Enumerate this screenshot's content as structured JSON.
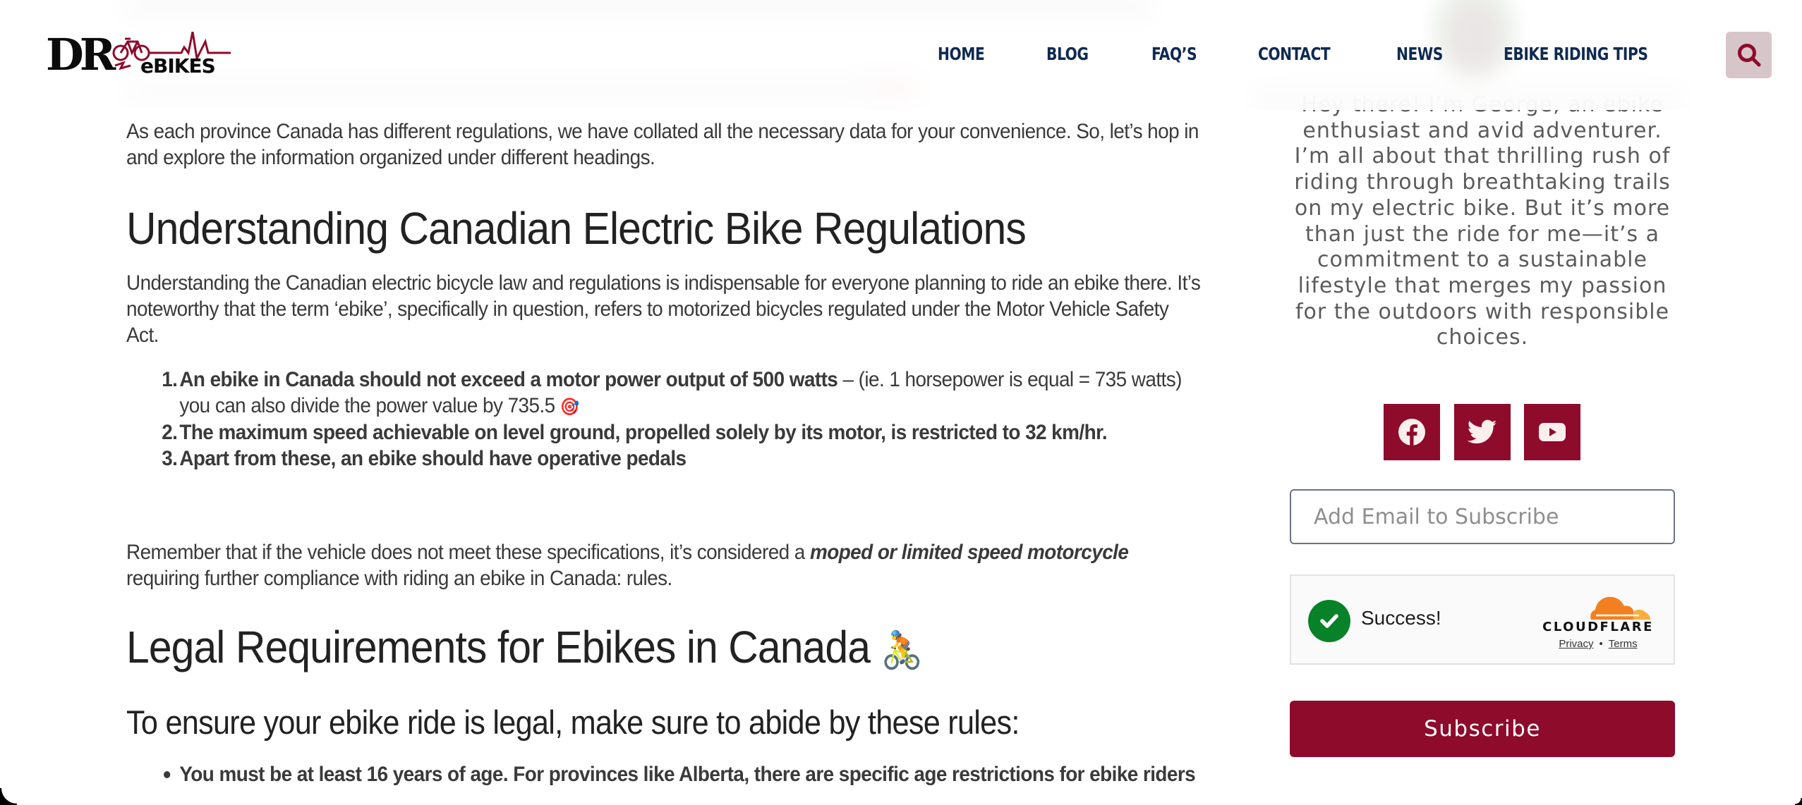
{
  "header": {
    "logo": {
      "primary": "DR",
      "secondary": "eBIKES",
      "alt": "DR eBIKES logo"
    },
    "nav": [
      {
        "label": "HOME"
      },
      {
        "label": "BLOG"
      },
      {
        "label": "FAQ’S"
      },
      {
        "label": "CONTACT"
      },
      {
        "label": "NEWS"
      },
      {
        "label": "EBIKE RIDING TIPS"
      }
    ],
    "search_icon": "search-icon"
  },
  "article": {
    "intro": "As each province Canada has different regulations, we have collated all the necessary data for your convenience. So, let’s hop in and explore the information organized under different headings.",
    "section1": {
      "heading": "Understanding Canadian Electric Bike Regulations",
      "paragraph": "Understanding the Canadian electric bicycle law and regulations is indispensable for everyone planning to ride an ebike there. It’s noteworthy that the term ‘ebike’, specifically in question, refers to motorized bicycles regulated under the Motor Vehicle Safety Act.",
      "list": [
        {
          "num": "1.",
          "bold": "An ebike in Canada should not exceed a motor power output of 500 watts",
          "rest": " – (ie. 1 horsepower is equal = 735 watts) you can also divide the power value by 735.5 ",
          "emoji": "🎯"
        },
        {
          "num": "2.",
          "bold": "The maximum speed achievable on level ground, propelled solely by its motor, is restricted to 32 km/hr.",
          "rest": "",
          "emoji": ""
        },
        {
          "num": "3.",
          "bold": "Apart from these, an ebike should have operative pedals",
          "rest": "",
          "emoji": ""
        }
      ],
      "remember_before": "Remember that if the vehicle does not meet these specifications, it’s considered a ",
      "remember_emphasis": "moped or limited speed motorcycle",
      "remember_after": " requiring further compliance with riding an ebike in Canada: rules."
    },
    "section2": {
      "heading": "Legal Requirements for Ebikes in Canada",
      "heading_emoji": "🚴",
      "subheading": "To ensure your ebike ride is legal, make sure to abide by these rules:",
      "bullets": [
        "You must be at least 16 years of age. For provinces like Alberta, there are specific age restrictions for ebike riders"
      ]
    }
  },
  "sidebar": {
    "bio": "Hey there! I’m George, an ebike enthusiast and avid adventurer. I’m all about that thrilling rush of riding through breathtaking trails on my electric bike. But it’s more than just the ride for me—it’s a commitment to a sustainable lifestyle that merges my passion for the outdoors with responsible choices.",
    "social": [
      {
        "name": "facebook",
        "icon": "facebook-icon"
      },
      {
        "name": "twitter",
        "icon": "twitter-icon"
      },
      {
        "name": "youtube",
        "icon": "youtube-icon"
      }
    ],
    "subscribe": {
      "email_placeholder": "Add Email to Subscribe",
      "email_value": "",
      "captcha": {
        "status": "Success!",
        "brand": "CLOUDFLARE",
        "privacy_label": "Privacy",
        "separator": "•",
        "terms_label": "Terms"
      },
      "button_label": "Subscribe"
    }
  },
  "colors": {
    "brand": "#8e0b2b",
    "nav_text": "#0f2a52",
    "search_bg": "#d6c5c9",
    "success": "#078228",
    "cloudflare_orange": "#f38020"
  }
}
